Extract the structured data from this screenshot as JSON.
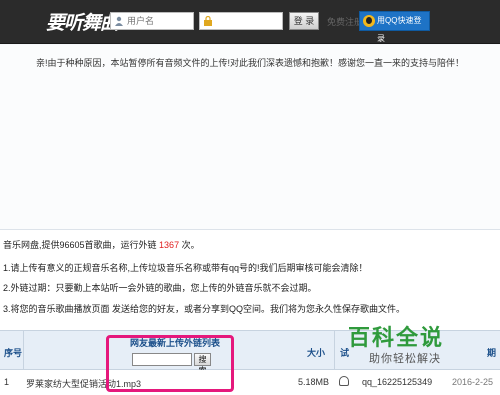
{
  "header": {
    "logo": "要听舞曲",
    "username_placeholder": "用户名",
    "password_placeholder": "",
    "login_label": "登 录",
    "register_label": "免费注册",
    "qq_login_label": "用QQ快速登录"
  },
  "notice": "亲!由于种种原因，本站暂停所有音频文件的上传!对此我们深表遗憾和抱歉！感谢您一直一来的支持与陪伴！",
  "info": {
    "line1_prefix": "音乐网盘,提供96605首歌曲，运行外链",
    "line1_count": "1367",
    "line1_suffix": "次。",
    "line2": "1.请上传有意义的正规音乐名称,上传垃圾音乐名称或带有qq号的!我们后期审核可能会清除！",
    "line3": "2.外链过期：只要勤上本站听一会外链的歌曲，您上传的外链音乐就不会过期。",
    "line4": "3.将您的音乐歌曲播放页面 发送给您的好友，或者分享到QQ空间。我们将为您永久性保存歌曲文件。"
  },
  "table": {
    "col_index": "序号",
    "list_title": "网友最新上传外链列表",
    "search_button": "搜索",
    "col_size": "大小",
    "col_listen": "试",
    "col_date": "期",
    "rows": [
      {
        "index": "1",
        "name": "罗莱家纺大型促销活动1.mp3",
        "size": "5.18MB",
        "user": "qq_16225125349",
        "date": "2016-2-25"
      }
    ]
  },
  "watermark": {
    "big": "百科全说",
    "small": "助你轻松解决"
  },
  "colors": {
    "topbar": "#2b2b2b",
    "accent_red": "#e02020",
    "highlight": "#e5187c",
    "qq_blue": "#1e73c6",
    "watermark_green": "#2f9a3c"
  }
}
